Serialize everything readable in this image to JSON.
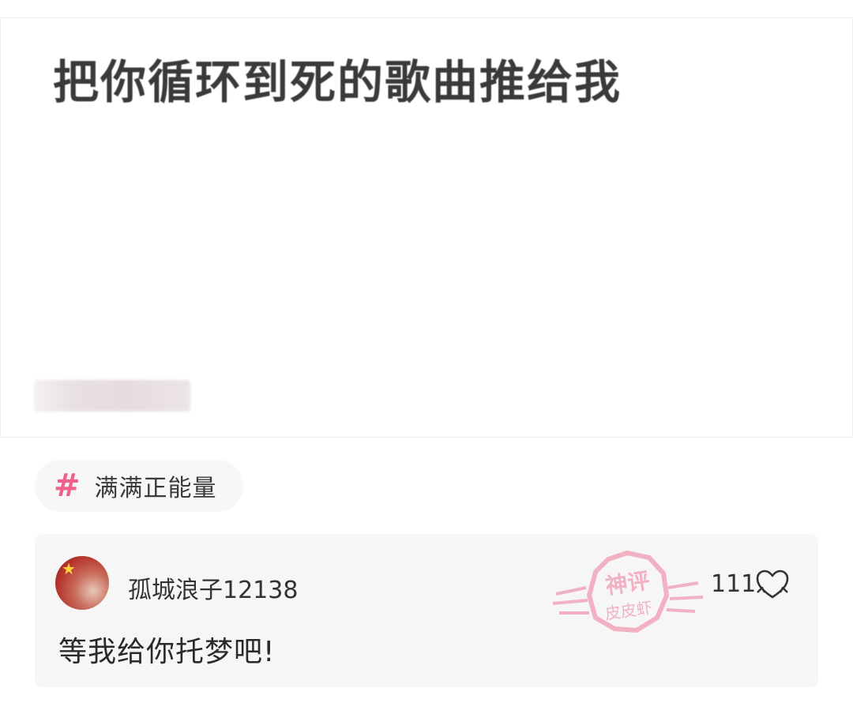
{
  "post": {
    "title": "把你循环到死的歌曲推给我"
  },
  "tag": {
    "icon": "hashtag-icon",
    "symbol": "#",
    "label": "满满正能量",
    "color": "#f0608a"
  },
  "comment": {
    "username": "孤城浪子12138",
    "likes": "111",
    "like_icon": "heart-outline-icon",
    "text": "等我给你托梦吧!",
    "watermark": {
      "top": "神评",
      "bottom": "皮皮虾",
      "color": "#f07a9a"
    }
  }
}
